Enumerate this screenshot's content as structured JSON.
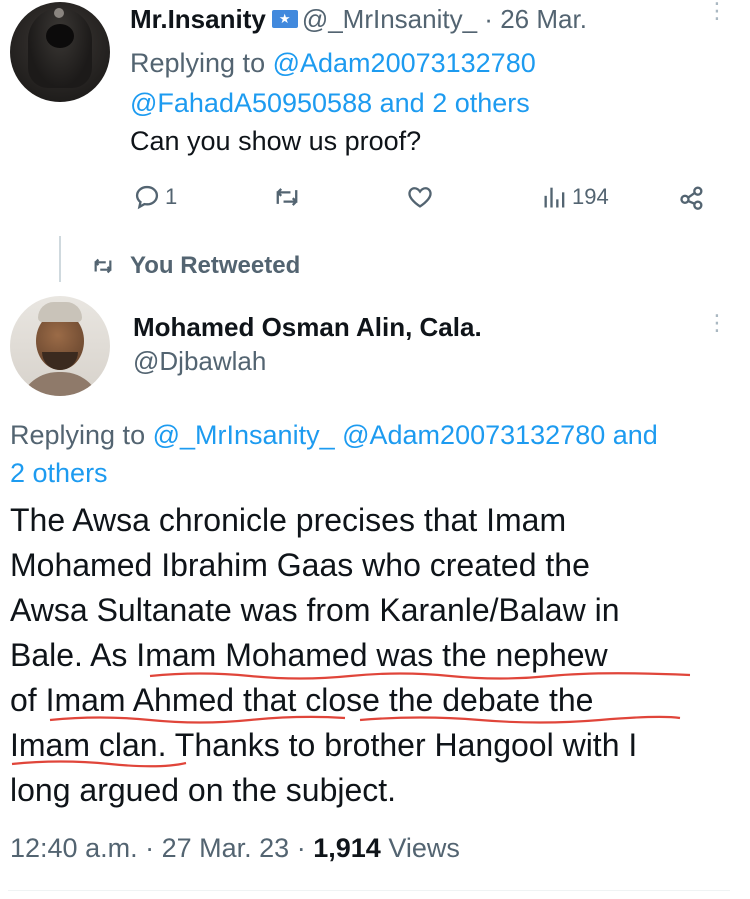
{
  "tweet1": {
    "display_name": "Mr.Insanity",
    "handle": "@_MrInsanity_",
    "time_sep": "·",
    "date": "26 Mar.",
    "replying_prefix": "Replying to",
    "replying_handle1": "@Adam20073132780",
    "replying_handle2": "@FahadA50950588",
    "replying_and": "and",
    "replying_others": "2 others",
    "text": "Can you show us proof?",
    "replies": "1",
    "views": "194"
  },
  "retweet_label": "You Retweeted",
  "tweet2": {
    "display_name": "Mohamed Osman Alin, Cala.",
    "handle": "@Djbawlah",
    "replying_prefix": "Replying to",
    "replying_handle1": "@_MrInsanity_",
    "replying_handle2": "@Adam20073132780",
    "replying_and": "and",
    "replying_others": "2 others",
    "text_lines": [
      "The Awsa chronicle precises that Imam",
      "Mohamed Ibrahim Gaas who created the",
      "Awsa Sultanate was from Karanle/Balaw in",
      "Bale. As Imam Mohamed was the nephew",
      "of Imam Ahmed that close the debate the",
      "Imam clan. Thanks to brother Hangool with I",
      "long argued on the subject."
    ],
    "time": "12:40 a.m.",
    "sep": "·",
    "date": "27 Mar. 23",
    "views_count": "1,914",
    "views_label": "Views"
  },
  "colors": {
    "link": "#1d9bf0",
    "secondary": "#536471",
    "underline": "#e0453a"
  },
  "icons": [
    "reply-icon",
    "retweet-icon",
    "like-icon",
    "views-icon",
    "share-icon",
    "more-icon",
    "flag-icon"
  ]
}
